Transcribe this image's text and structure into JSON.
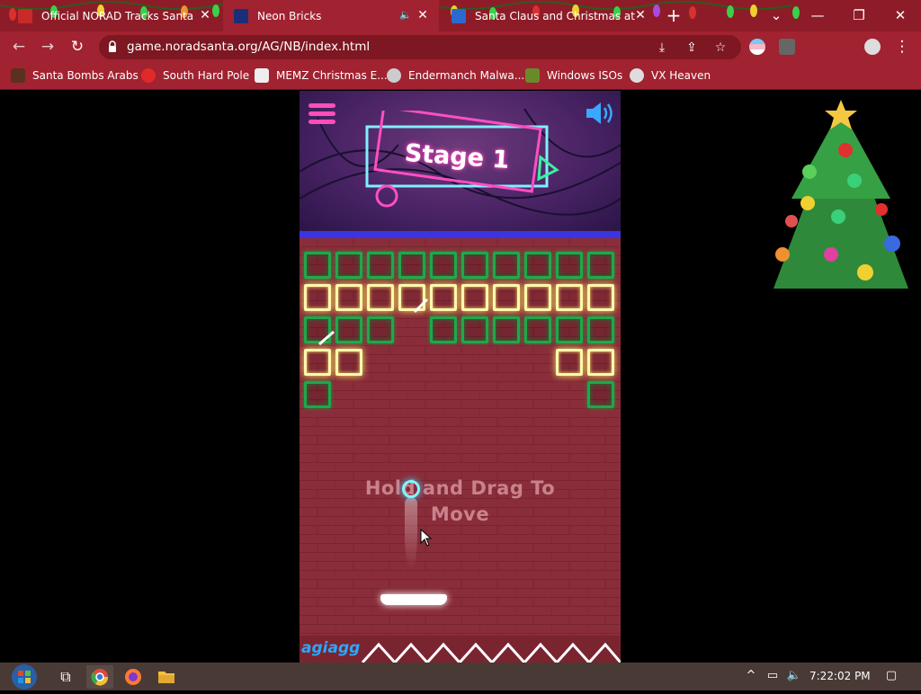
{
  "browser": {
    "tabs": [
      {
        "label": "Official NORAD Tracks Santa",
        "close": "✕"
      },
      {
        "label": "Neon Bricks",
        "close": "✕"
      },
      {
        "label": "Santa Claus and Christmas at the",
        "close": "✕"
      }
    ],
    "new_tab": "+",
    "url": "game.noradsanta.org/AG/NB/index.html",
    "bookmarks": [
      {
        "label": "Santa Bombs Arabs"
      },
      {
        "label": "South Hard Pole"
      },
      {
        "label": "MEMZ Christmas E..."
      },
      {
        "label": "Endermanch Malwa..."
      },
      {
        "label": "Windows ISOs"
      },
      {
        "label": "VX Heaven"
      }
    ]
  },
  "game": {
    "stage_label": "Stage 1",
    "hint_line1": "Hold and Drag To",
    "hint_line2": "Move",
    "brand": "agiagg"
  },
  "taskbar": {
    "time": "7:22:02 PM"
  },
  "colors": {
    "chrome_red": "#a12230",
    "brick_green": "#1ea84a",
    "brick_yellow": "#fff8b0",
    "ball_cyan": "#7ff6ff"
  }
}
